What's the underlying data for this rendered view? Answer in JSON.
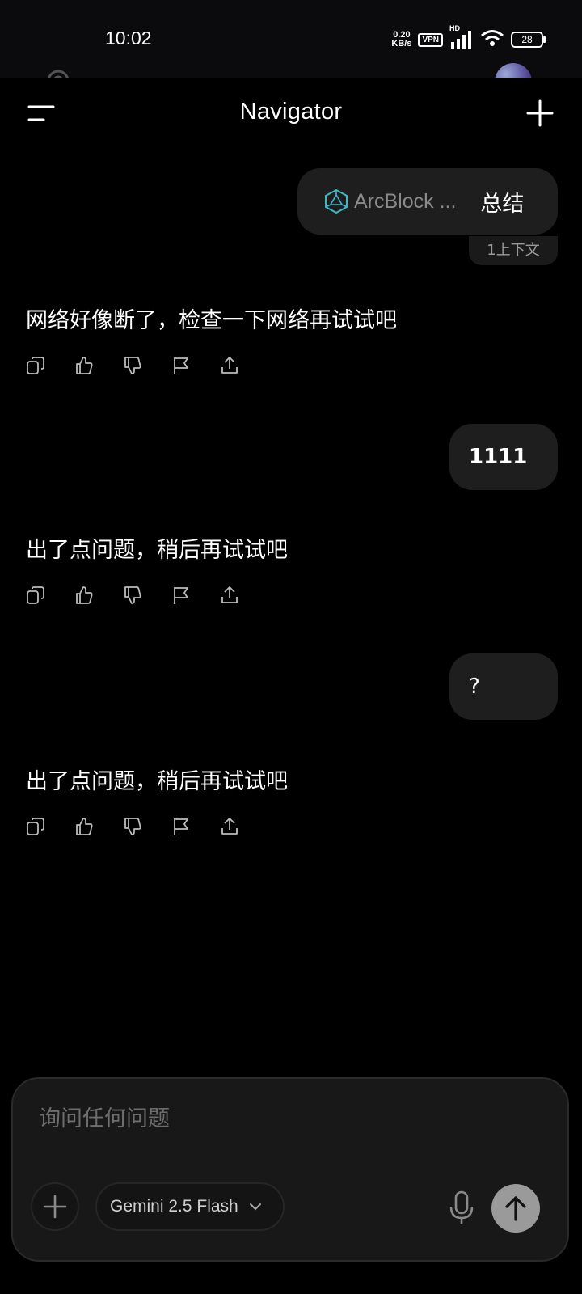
{
  "status": {
    "time": "10:02",
    "netspeed_value": "0.20",
    "netspeed_unit": "KB/s",
    "vpn": "VPN",
    "hd": "HD",
    "battery": "28"
  },
  "header": {
    "title": "Navigator"
  },
  "conversation": {
    "msg1": {
      "attachment": "ArcBlock ...",
      "text": "总结",
      "context": "1上下文"
    },
    "reply1": "网络好像断了，检查一下网络再试试吧",
    "msg2": "1111",
    "reply2": "出了点问题，稍后再试试吧",
    "msg3": "?",
    "reply3": "出了点问题，稍后再试试吧"
  },
  "composer": {
    "placeholder": "询问任何问题",
    "model": "Gemini 2.5 Flash"
  },
  "colors": {
    "background": "#000000",
    "bubble": "#1e1e1e",
    "composer": "#181818",
    "send": "#9a9a9a",
    "arcblock_logo": "#3fb8c8"
  },
  "icons": [
    "menu-icon",
    "plus-icon",
    "arcblock-logo-icon",
    "copy-icon",
    "thumbs-up-icon",
    "thumbs-down-icon",
    "flag-icon",
    "share-icon",
    "mic-icon",
    "arrow-up-icon",
    "chevron-down-icon",
    "wifi-icon",
    "signal-icon",
    "battery-icon"
  ]
}
